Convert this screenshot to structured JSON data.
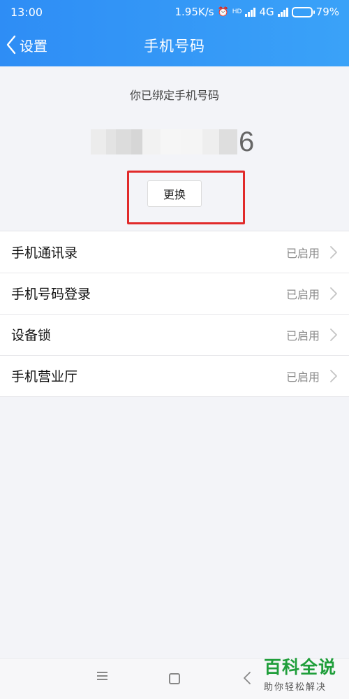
{
  "status_bar": {
    "time": "13:00",
    "network_speed": "1.95K/s",
    "alarm_icon": "alarm-icon",
    "hd_badge": "HD",
    "network_type": "4G",
    "battery": "79%",
    "battery_level": 0.79
  },
  "nav": {
    "back_label": "设置",
    "title": "手机号码"
  },
  "bind": {
    "caption": "你已绑定手机号码",
    "number_tail": "6",
    "change_label": "更换",
    "highlight_color": "#e12a2a"
  },
  "settings": {
    "items": [
      {
        "label": "手机通讯录",
        "status": "已启用"
      },
      {
        "label": "手机号码登录",
        "status": "已启用"
      },
      {
        "label": "设备锁",
        "status": "已启用"
      },
      {
        "label": "手机营业厅",
        "status": "已启用"
      }
    ]
  },
  "watermark": {
    "title": "百科全说",
    "subtitle": "助你轻松解决"
  },
  "colors": {
    "header_start": "#2e8df5",
    "header_end": "#3aa2f8",
    "background": "#f3f4f8",
    "watermark_green": "#1f9e3a"
  }
}
